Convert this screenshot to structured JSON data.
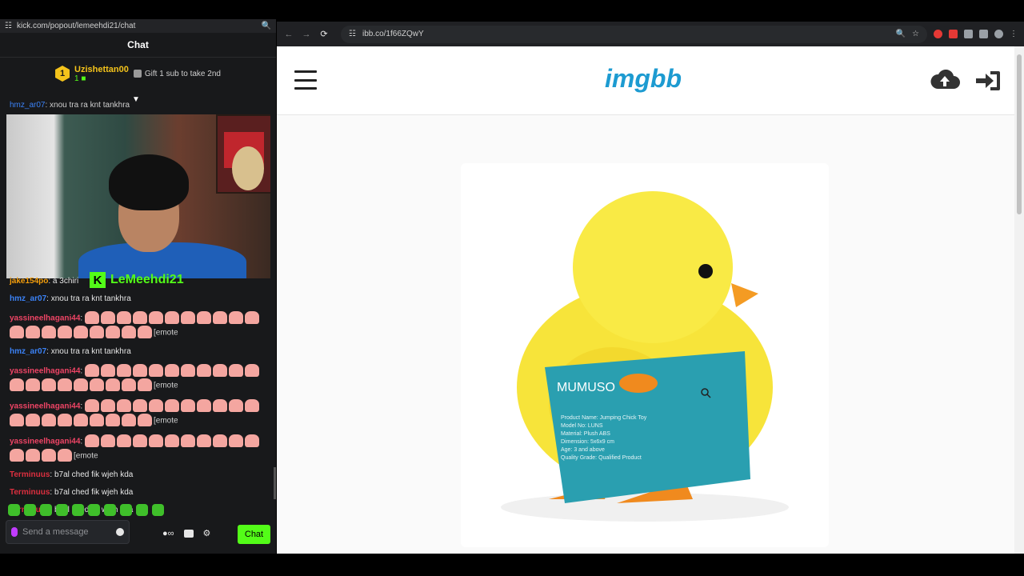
{
  "kick": {
    "url": "kick.com/popout/lemeehdi21/chat",
    "header": "Chat",
    "pinned": {
      "rank": "1",
      "username": "Uzishettan00",
      "sub_count": "1",
      "gift_text": "Gift 1 sub to take 2nd"
    },
    "partial_message": {
      "user": "hmz_ar07",
      "text": ": xnou tra ra knt tankhra"
    },
    "streamer_overlay": "LeMeehdi21",
    "messages": [
      {
        "user": "jake154po",
        "text": ": a 3chiri",
        "color": "orange",
        "emotes": 0
      },
      {
        "user": "hmz_ar07",
        "text": ": xnou tra ra knt tankhra",
        "color": "blue",
        "emotes": 0
      },
      {
        "user": "yassineelhagani44",
        "text": "[emote",
        "color": "pink",
        "emotes": 20
      },
      {
        "user": "hmz_ar07",
        "text": ": xnou tra ra knt tankhra",
        "color": "blue",
        "emotes": 0
      },
      {
        "user": "yassineelhagani44",
        "text": "[emote",
        "color": "pink",
        "emotes": 20
      },
      {
        "user": "yassineelhagani44",
        "text": "[emote",
        "color": "pink",
        "emotes": 20
      },
      {
        "user": "yassineelhagani44",
        "text": "[emote",
        "color": "pink",
        "emotes": 15
      },
      {
        "user": "Terminuus",
        "text": ": b7al ched fik wjeh kda",
        "color": "red",
        "emotes": 0
      },
      {
        "user": "Terminuus",
        "text": ": b7al ched fik wjeh kda",
        "color": "red",
        "emotes": 0
      },
      {
        "user": "Terminuus",
        "text": ": b7al ched fik wjeh kda",
        "color": "red",
        "emotes": 0
      }
    ],
    "input_placeholder": "Send a message",
    "chat_button": "Chat",
    "accent": "#53fc18"
  },
  "browser": {
    "url": "ibb.co/1f66ZQwY",
    "site_logo": "imgbb",
    "image": {
      "brand_tag": "MUMUSO",
      "tag_lines": [
        "Product Name: Jumping Chick Toy",
        "Model No: LUNS",
        "Material: Plush ABS",
        "Dimension: 5x6x9 cm",
        "Age: 3 and above",
        "Quality Grade: Qualified Product"
      ]
    }
  }
}
